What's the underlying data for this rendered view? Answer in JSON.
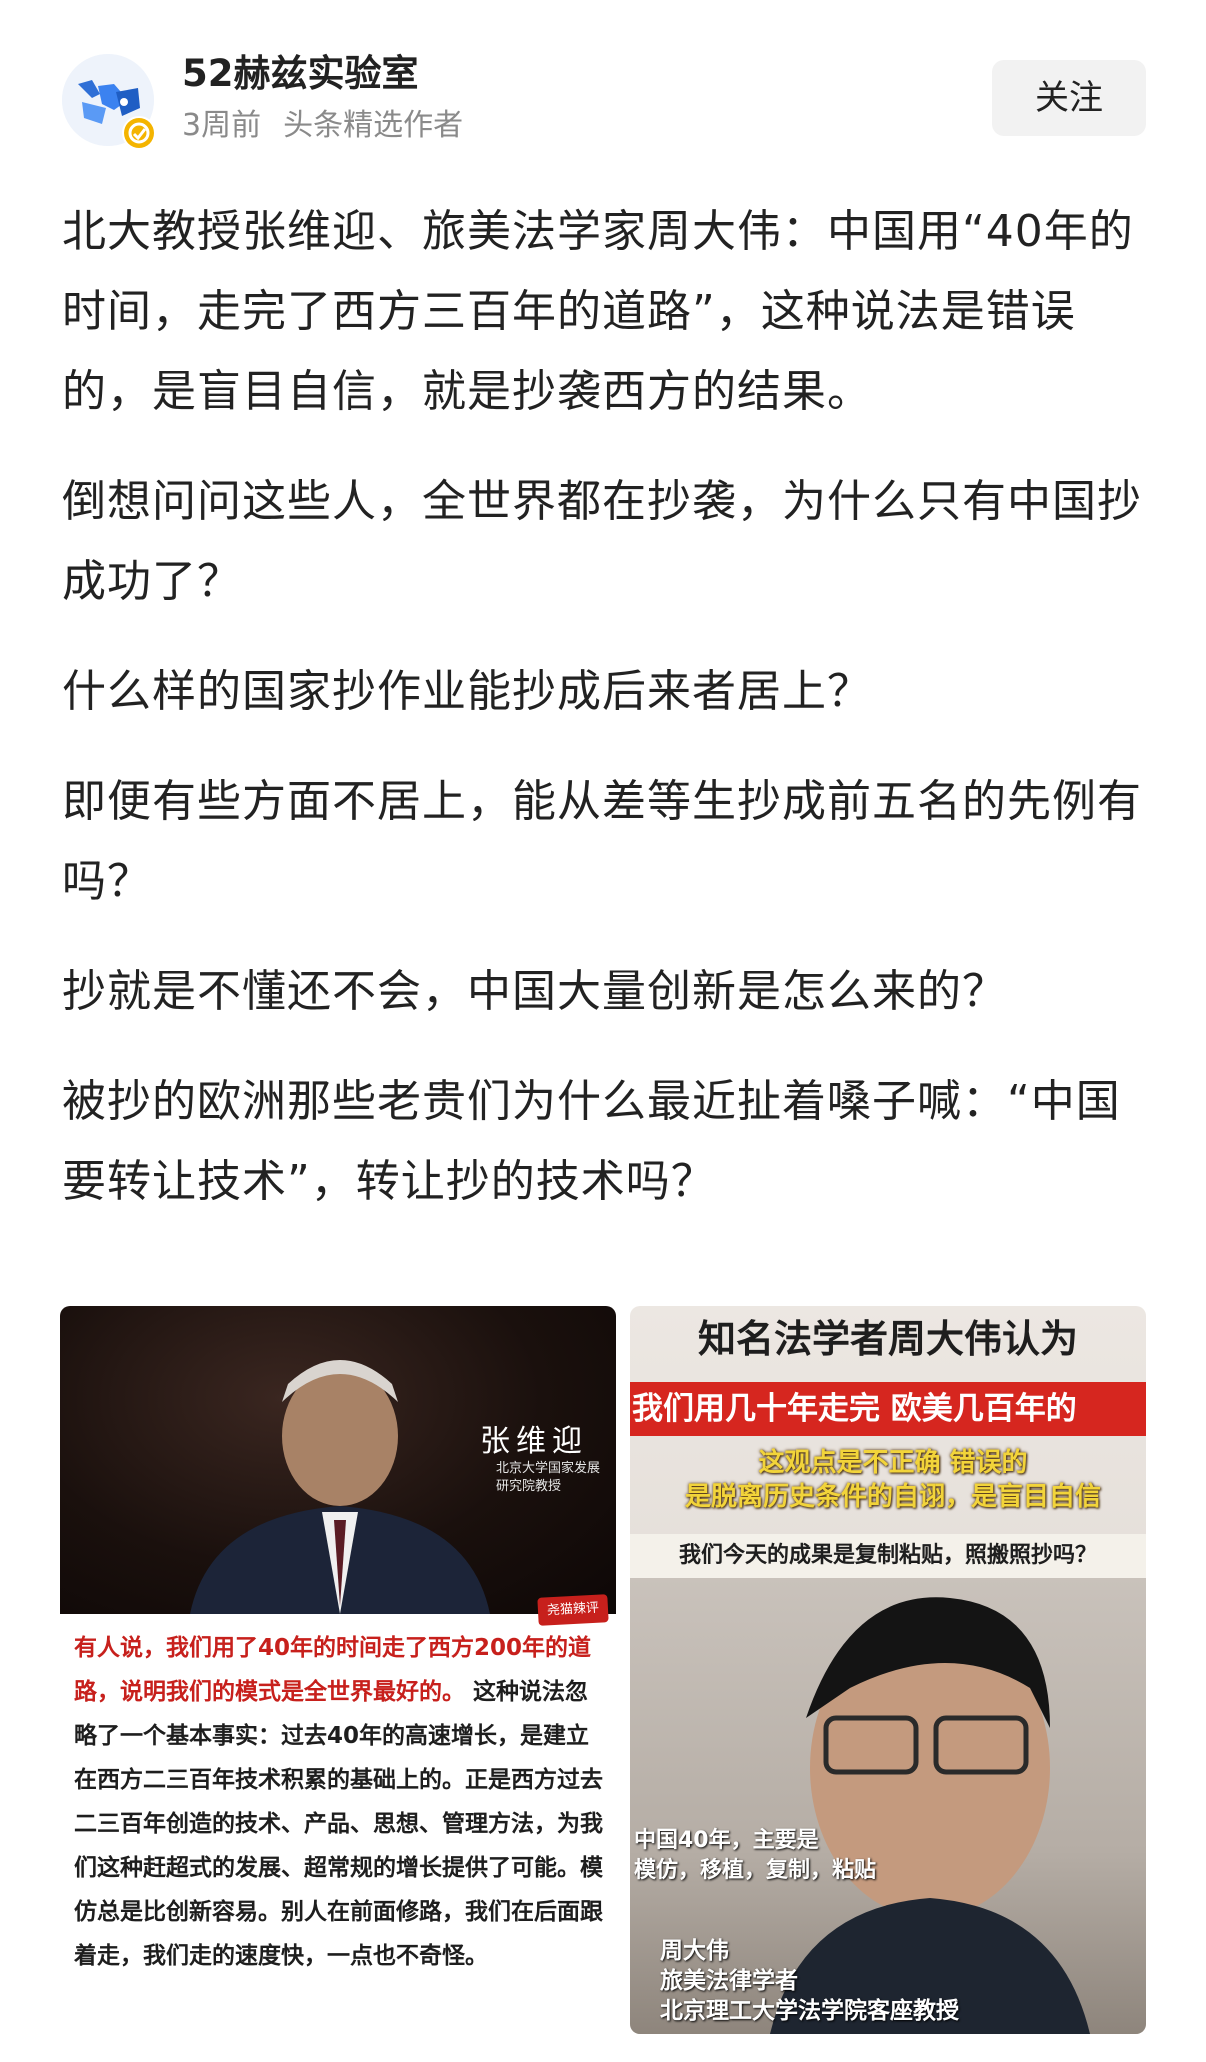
{
  "header": {
    "author_name": "52赫兹实验室",
    "time_ago": "3周前",
    "author_role": "头条精选作者",
    "follow_label": "关注"
  },
  "article": {
    "paragraphs": [
      "北大教授张维迎、旅美法学家周大伟：中国用“40年的时间，走完了西方三百年的道路”，这种说法是错误的，是盲目自信，就是抄袭西方的结果。",
      "倒想问问这些人，全世界都在抄袭，为什么只有中国抄成功了？",
      "什么样的国家抄作业能抄成后来者居上？",
      "即便有些方面不居上，能从差等生抄成前五名的先例有吗？",
      "抄就是不懂还不会，中国大量创新是怎么来的？",
      "被抄的欧洲那些老贵们为什么最近扯着嗓子喊：“中国要转让技术”，转让抄的技术吗？"
    ]
  },
  "image_left": {
    "person_name": "张维迎",
    "person_title": "北京大学国家发展研究院教授",
    "stamp": "尧猫辣评",
    "caption_red": "有人说，我们用了40年的时间走了西方200年的道路，说明我们的模式是全世界最好的。",
    "caption_body": "这种说法忽略了一个基本事实：过去40年的高速增长，是建立在西方二三百年技术积累的基础上的。正是西方过去二三百年创造的技术、产品、思想、管理方法，为我们这种赶超式的发展、超常规的增长提供了可能。模仿总是比创新容易。别人在前面修路，我们在后面跟着走，我们走的速度快，一点也不奇怪。"
  },
  "image_right": {
    "headline": "知名法学者周大伟认为",
    "red_band": "我们用几十年走完 欧美几百年的",
    "yellow_line1": "这观点是不正确 错误的",
    "yellow_line2": "是脱离历史条件的自诩，是盲目自信",
    "white_band": "我们今天的成果是复制粘贴，照搬照抄吗？",
    "sub_line1": "中国40年，主要是",
    "sub_line2": "模仿，移植，复制，粘贴",
    "name": "周大伟",
    "role1": "旅美法律学者",
    "role2": "北京理工大学法学院客座教授"
  },
  "colors": {
    "accent_red": "#c7201c",
    "follow_bg": "#f2f2f2",
    "meta_gray": "#8a8a8a"
  },
  "icons": {
    "avatar": "blue-logo-avatar",
    "badge": "verified-badge-icon"
  }
}
